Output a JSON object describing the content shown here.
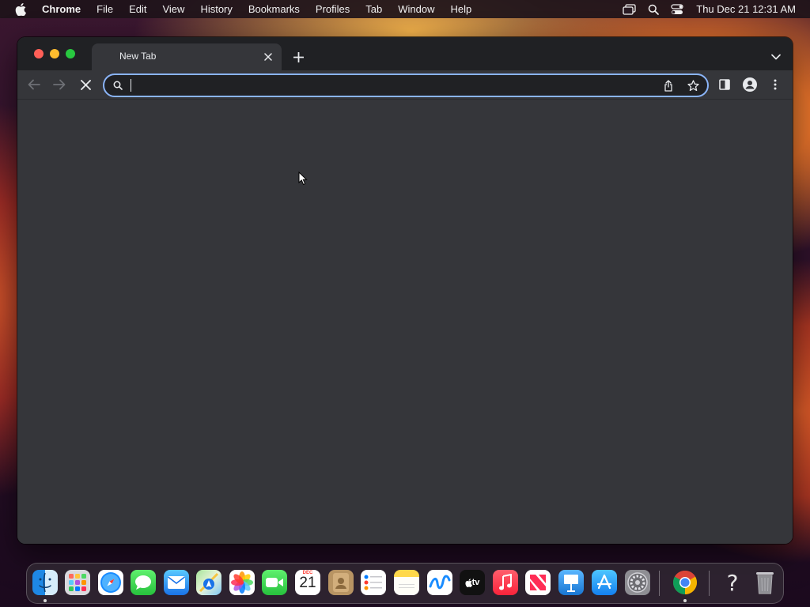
{
  "menubar": {
    "app_name": "Chrome",
    "items": [
      "File",
      "Edit",
      "View",
      "History",
      "Bookmarks",
      "Profiles",
      "Tab",
      "Window",
      "Help"
    ],
    "clock": "Thu Dec 21  12:31 AM",
    "status_icons": [
      "window-switcher-icon",
      "spotlight-search-icon",
      "control-center-icon"
    ]
  },
  "browser": {
    "tab": {
      "title": "New Tab"
    },
    "omnibox": {
      "value": "",
      "placeholder": ""
    },
    "accent_color": "#8ab4f8",
    "toolbar_icons": [
      "back-icon",
      "forward-icon",
      "stop-icon",
      "share-icon",
      "bookmark-star-icon",
      "side-panel-icon",
      "profile-icon",
      "menu-icon"
    ]
  },
  "dock": {
    "calendar": {
      "month": "DEC",
      "day": "21"
    },
    "tv_label": "tv",
    "help_glyph": "?",
    "apps": [
      "Finder",
      "Launchpad",
      "Safari",
      "Messages",
      "Mail",
      "Maps",
      "Photos",
      "FaceTime",
      "Calendar",
      "Contacts",
      "Reminders",
      "Notes",
      "Freeform",
      "TV",
      "Music",
      "News",
      "Keynote",
      "App Store",
      "System Settings",
      "Google Chrome",
      "Help",
      "Trash"
    ]
  }
}
